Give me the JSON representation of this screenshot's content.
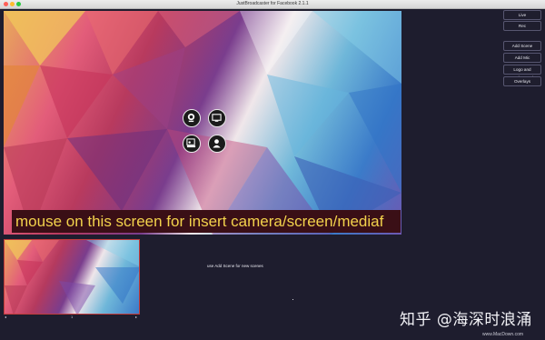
{
  "window": {
    "title": "JustBroadcaster for Facebook 2.1.1"
  },
  "preview": {
    "caption": "mouse on this screen for insert camera/screen/mediaf",
    "source_buttons": [
      {
        "name": "camera-icon"
      },
      {
        "name": "screen-icon"
      },
      {
        "name": "media-icon"
      },
      {
        "name": "user-icon"
      }
    ]
  },
  "sidebar": {
    "live_label": "Live",
    "rec_label": "Rec",
    "add_scene_label": "Add Scene",
    "add_mic_label": "Add Mic",
    "logo_background_label": "Logo and Background",
    "overlays_label": "Overlays"
  },
  "scenes": {
    "hint": "use Add Scene for new scenes",
    "page_label": "1"
  },
  "watermark": {
    "main": "知乎 @海深时浪涌",
    "site": "www.MacDown.com"
  },
  "colors": {
    "background": "#1d1c2c",
    "caption_bg": "#3a0f16",
    "caption_text": "#f3d24c",
    "selected_border": "#c23b3b"
  }
}
